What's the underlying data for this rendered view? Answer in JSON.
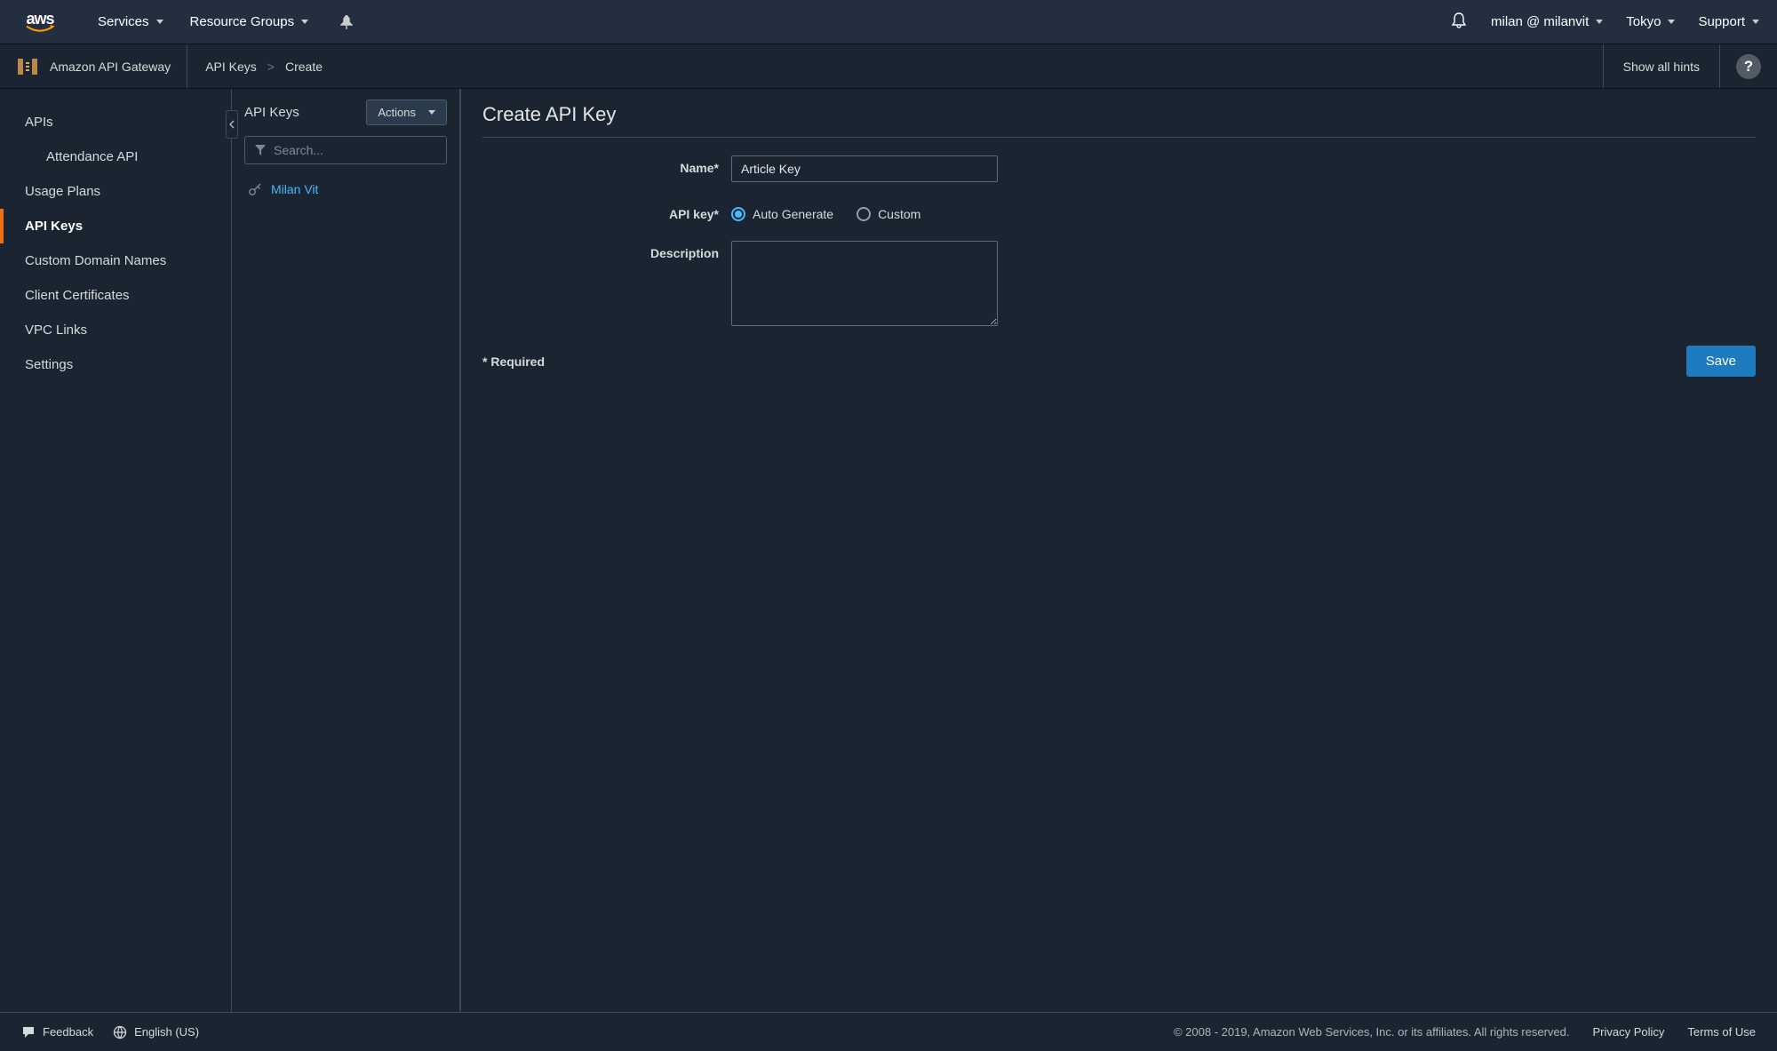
{
  "topnav": {
    "services": "Services",
    "resource_groups": "Resource Groups",
    "user": "milan @ milanvit",
    "region": "Tokyo",
    "support": "Support"
  },
  "subheader": {
    "service_name": "Amazon API Gateway",
    "breadcrumb": [
      "API Keys",
      "Create"
    ],
    "show_hints": "Show all hints"
  },
  "sidebar": {
    "items": [
      {
        "label": "APIs"
      },
      {
        "label": "Attendance API",
        "child": true
      },
      {
        "label": "Usage Plans"
      },
      {
        "label": "API Keys",
        "active": true
      },
      {
        "label": "Custom Domain Names"
      },
      {
        "label": "Client Certificates"
      },
      {
        "label": "VPC Links"
      },
      {
        "label": "Settings"
      }
    ]
  },
  "keys_panel": {
    "title": "API Keys",
    "actions_label": "Actions",
    "search_placeholder": "Search...",
    "items": [
      "Milan Vit"
    ]
  },
  "form": {
    "title": "Create API Key",
    "name_label": "Name*",
    "name_value": "Article Key",
    "apikey_label": "API key*",
    "radio_auto": "Auto Generate",
    "radio_custom": "Custom",
    "description_label": "Description",
    "description_value": "",
    "required_note": "* Required",
    "save_label": "Save"
  },
  "footer": {
    "feedback": "Feedback",
    "language": "English (US)",
    "copyright": "© 2008 - 2019, Amazon Web Services, Inc. or its affiliates. All rights reserved.",
    "privacy": "Privacy Policy",
    "terms": "Terms of Use"
  }
}
